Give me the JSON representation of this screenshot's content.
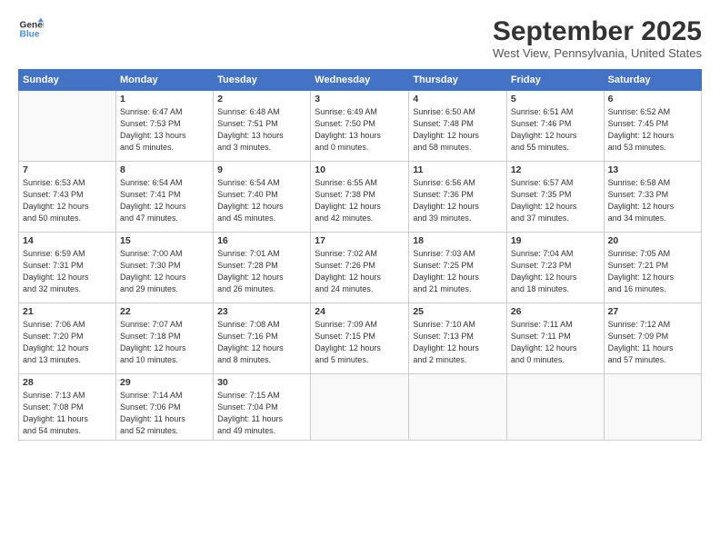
{
  "header": {
    "logo_line1": "General",
    "logo_line2": "Blue",
    "month_title": "September 2025",
    "location": "West View, Pennsylvania, United States"
  },
  "weekdays": [
    "Sunday",
    "Monday",
    "Tuesday",
    "Wednesday",
    "Thursday",
    "Friday",
    "Saturday"
  ],
  "weeks": [
    [
      {
        "day": "",
        "info": ""
      },
      {
        "day": "1",
        "info": "Sunrise: 6:47 AM\nSunset: 7:53 PM\nDaylight: 13 hours\nand 5 minutes."
      },
      {
        "day": "2",
        "info": "Sunrise: 6:48 AM\nSunset: 7:51 PM\nDaylight: 13 hours\nand 3 minutes."
      },
      {
        "day": "3",
        "info": "Sunrise: 6:49 AM\nSunset: 7:50 PM\nDaylight: 13 hours\nand 0 minutes."
      },
      {
        "day": "4",
        "info": "Sunrise: 6:50 AM\nSunset: 7:48 PM\nDaylight: 12 hours\nand 58 minutes."
      },
      {
        "day": "5",
        "info": "Sunrise: 6:51 AM\nSunset: 7:46 PM\nDaylight: 12 hours\nand 55 minutes."
      },
      {
        "day": "6",
        "info": "Sunrise: 6:52 AM\nSunset: 7:45 PM\nDaylight: 12 hours\nand 53 minutes."
      }
    ],
    [
      {
        "day": "7",
        "info": "Sunrise: 6:53 AM\nSunset: 7:43 PM\nDaylight: 12 hours\nand 50 minutes."
      },
      {
        "day": "8",
        "info": "Sunrise: 6:54 AM\nSunset: 7:41 PM\nDaylight: 12 hours\nand 47 minutes."
      },
      {
        "day": "9",
        "info": "Sunrise: 6:54 AM\nSunset: 7:40 PM\nDaylight: 12 hours\nand 45 minutes."
      },
      {
        "day": "10",
        "info": "Sunrise: 6:55 AM\nSunset: 7:38 PM\nDaylight: 12 hours\nand 42 minutes."
      },
      {
        "day": "11",
        "info": "Sunrise: 6:56 AM\nSunset: 7:36 PM\nDaylight: 12 hours\nand 39 minutes."
      },
      {
        "day": "12",
        "info": "Sunrise: 6:57 AM\nSunset: 7:35 PM\nDaylight: 12 hours\nand 37 minutes."
      },
      {
        "day": "13",
        "info": "Sunrise: 6:58 AM\nSunset: 7:33 PM\nDaylight: 12 hours\nand 34 minutes."
      }
    ],
    [
      {
        "day": "14",
        "info": "Sunrise: 6:59 AM\nSunset: 7:31 PM\nDaylight: 12 hours\nand 32 minutes."
      },
      {
        "day": "15",
        "info": "Sunrise: 7:00 AM\nSunset: 7:30 PM\nDaylight: 12 hours\nand 29 minutes."
      },
      {
        "day": "16",
        "info": "Sunrise: 7:01 AM\nSunset: 7:28 PM\nDaylight: 12 hours\nand 26 minutes."
      },
      {
        "day": "17",
        "info": "Sunrise: 7:02 AM\nSunset: 7:26 PM\nDaylight: 12 hours\nand 24 minutes."
      },
      {
        "day": "18",
        "info": "Sunrise: 7:03 AM\nSunset: 7:25 PM\nDaylight: 12 hours\nand 21 minutes."
      },
      {
        "day": "19",
        "info": "Sunrise: 7:04 AM\nSunset: 7:23 PM\nDaylight: 12 hours\nand 18 minutes."
      },
      {
        "day": "20",
        "info": "Sunrise: 7:05 AM\nSunset: 7:21 PM\nDaylight: 12 hours\nand 16 minutes."
      }
    ],
    [
      {
        "day": "21",
        "info": "Sunrise: 7:06 AM\nSunset: 7:20 PM\nDaylight: 12 hours\nand 13 minutes."
      },
      {
        "day": "22",
        "info": "Sunrise: 7:07 AM\nSunset: 7:18 PM\nDaylight: 12 hours\nand 10 minutes."
      },
      {
        "day": "23",
        "info": "Sunrise: 7:08 AM\nSunset: 7:16 PM\nDaylight: 12 hours\nand 8 minutes."
      },
      {
        "day": "24",
        "info": "Sunrise: 7:09 AM\nSunset: 7:15 PM\nDaylight: 12 hours\nand 5 minutes."
      },
      {
        "day": "25",
        "info": "Sunrise: 7:10 AM\nSunset: 7:13 PM\nDaylight: 12 hours\nand 2 minutes."
      },
      {
        "day": "26",
        "info": "Sunrise: 7:11 AM\nSunset: 7:11 PM\nDaylight: 12 hours\nand 0 minutes."
      },
      {
        "day": "27",
        "info": "Sunrise: 7:12 AM\nSunset: 7:09 PM\nDaylight: 11 hours\nand 57 minutes."
      }
    ],
    [
      {
        "day": "28",
        "info": "Sunrise: 7:13 AM\nSunset: 7:08 PM\nDaylight: 11 hours\nand 54 minutes."
      },
      {
        "day": "29",
        "info": "Sunrise: 7:14 AM\nSunset: 7:06 PM\nDaylight: 11 hours\nand 52 minutes."
      },
      {
        "day": "30",
        "info": "Sunrise: 7:15 AM\nSunset: 7:04 PM\nDaylight: 11 hours\nand 49 minutes."
      },
      {
        "day": "",
        "info": ""
      },
      {
        "day": "",
        "info": ""
      },
      {
        "day": "",
        "info": ""
      },
      {
        "day": "",
        "info": ""
      }
    ]
  ]
}
